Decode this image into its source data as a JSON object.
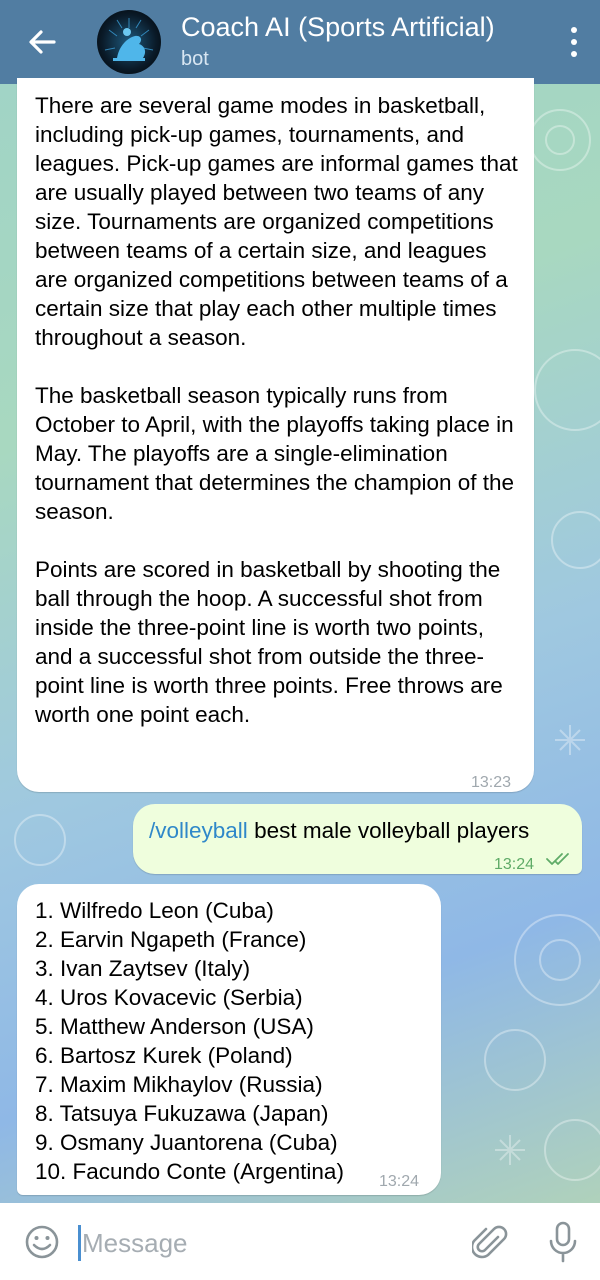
{
  "header": {
    "title": "Coach AI (Sports Artificial)",
    "subtitle": "bot"
  },
  "messages": [
    {
      "direction": "incoming",
      "text": "There are several game modes in basketball, including pick-up games, tournaments, and leagues. Pick-up games are informal games that are usually played between two teams of any size. Tournaments are organized competitions between teams of a certain size, and leagues are organized competitions between teams of a certain size that play each other multiple times throughout a season.\n\nThe basketball season typically runs from October to April, with the playoffs taking place in May. The playoffs are a single-elimination tournament that determines the champion of the season.\n\nPoints are scored in basketball by shooting the ball through the hoop. A successful shot from inside the three-point line is worth two points, and a successful shot from outside the three-point line is worth three points. Free throws are worth one point each.",
      "time": "13:23"
    },
    {
      "direction": "outgoing",
      "command": "/volleyball",
      "text": "best male volleyball players",
      "time": "13:24",
      "status": "read"
    },
    {
      "direction": "incoming",
      "items": [
        "1. Wilfredo Leon (Cuba)",
        "2. Earvin Ngapeth (France)",
        "3. Ivan Zaytsev (Italy)",
        "4. Uros Kovacevic (Serbia)",
        "5. Matthew Anderson (USA)",
        "6. Bartosz Kurek (Poland)",
        "7. Maxim Mikhaylov (Russia)",
        "8. Tatsuya Fukuzawa (Japan)",
        "9. Osmany Juantorena (Cuba)",
        "10. Facundo Conte (Argentina)"
      ],
      "time": "13:24"
    }
  ],
  "composer": {
    "placeholder": "Message",
    "value": ""
  },
  "colors": {
    "header_bg": "#517da2",
    "outgoing_bubble": "#effedd",
    "command_link": "#2f88c9",
    "read_check": "#5fab67"
  },
  "icons": [
    "back-arrow-icon",
    "more-vert-icon",
    "emoji-icon",
    "paperclip-icon",
    "microphone-icon",
    "double-check-icon"
  ]
}
